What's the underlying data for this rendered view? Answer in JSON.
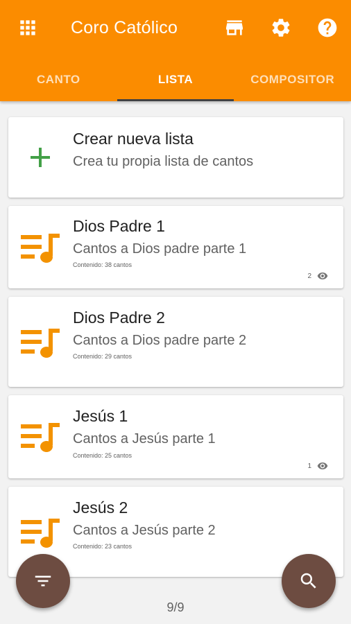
{
  "app": {
    "title": "Coro Católico",
    "accent_color": "#fb8c00",
    "fab_color": "#6d4c41"
  },
  "toolbar": {
    "icons": [
      "apps-icon",
      "store-icon",
      "settings-icon",
      "help-icon"
    ]
  },
  "tabs": [
    {
      "label": "CANTO",
      "active": false
    },
    {
      "label": "LISTA",
      "active": true
    },
    {
      "label": "COMPOSITOR",
      "active": false
    }
  ],
  "create_card": {
    "title": "Crear nueva lista",
    "subtitle": "Crea tu propia lista de cantos",
    "icon": "plus-icon"
  },
  "lists": [
    {
      "title": "Dios Padre 1",
      "subtitle": "Cantos a Dios padre parte 1",
      "content": "Contenido: 38 cantos",
      "views": "2"
    },
    {
      "title": "Dios Padre 2",
      "subtitle": "Cantos a Dios padre parte 2",
      "content": "Contenido: 29 cantos",
      "views": ""
    },
    {
      "title": "Jesús 1",
      "subtitle": "Cantos a Jesús parte 1",
      "content": "Contenido: 25 cantos",
      "views": "1"
    },
    {
      "title": "Jesús 2",
      "subtitle": "Cantos a Jesús parte 2",
      "content": "Contenido: 23 cantos",
      "views": ""
    }
  ],
  "pager": "9/9",
  "fabs": {
    "filter_icon": "filter-icon",
    "search_icon": "search-icon"
  }
}
